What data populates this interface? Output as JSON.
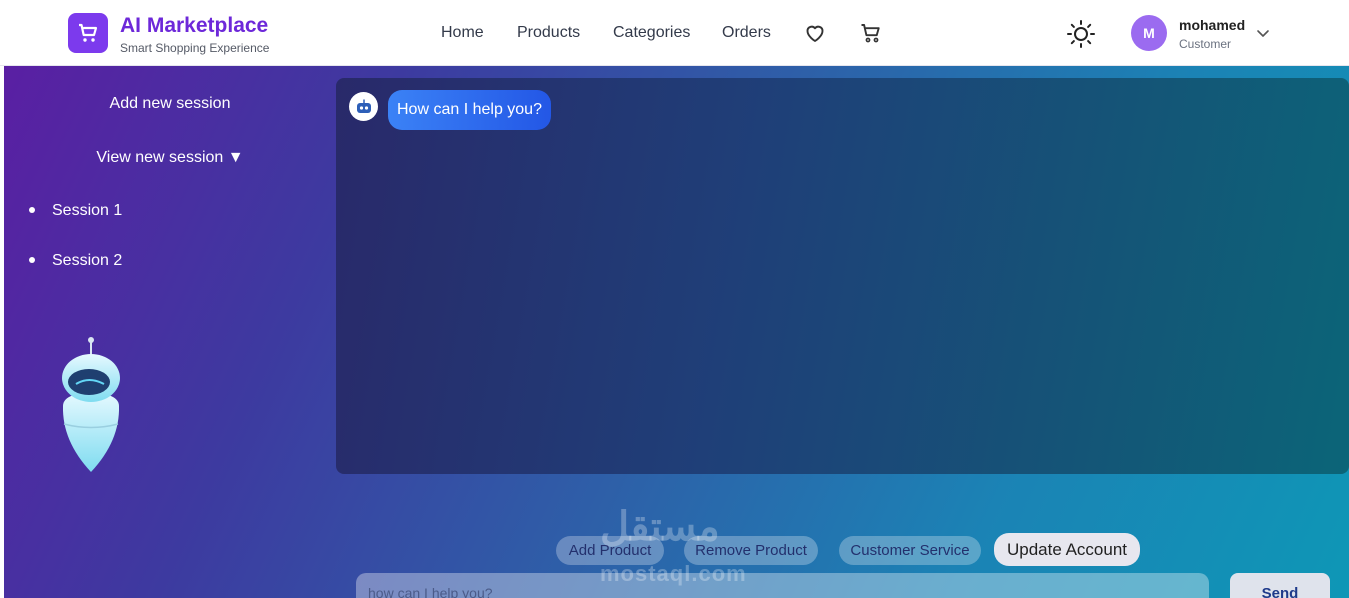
{
  "header": {
    "brand_title": "AI Marketplace",
    "brand_subtitle": "Smart Shopping Experience",
    "nav": [
      "Home",
      "Products",
      "Categories",
      "Orders"
    ],
    "icons": [
      "cart-logo-icon",
      "heart-icon",
      "cart-icon",
      "sun-icon",
      "chevron-down-icon"
    ],
    "user": {
      "initial": "M",
      "name": "mohamed",
      "role": "Customer"
    }
  },
  "sidebar": {
    "add_session": "Add new session",
    "view_session": "View new session ▼",
    "sessions": [
      "Session 1",
      "Session 2"
    ]
  },
  "chat": {
    "messages": [
      {
        "from": "bot",
        "text": "How can I help you?"
      }
    ]
  },
  "quick_actions": [
    "Add Product",
    "Remove Product",
    "Customer Service",
    "Update Account"
  ],
  "composer": {
    "placeholder": "how can I help you?",
    "send_label": "Send"
  },
  "watermark": {
    "arabic": "مستقل",
    "latin": "mostaql.com"
  },
  "colors": {
    "brand": "#6d28d9",
    "accent": "#7c3aed",
    "gradient_start": "#5a1fa3",
    "gradient_end": "#0e97b6"
  }
}
